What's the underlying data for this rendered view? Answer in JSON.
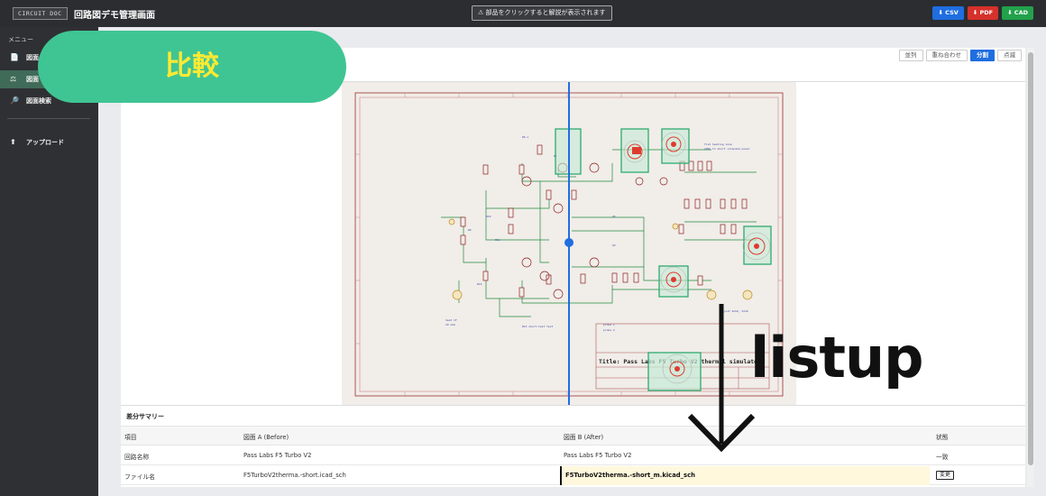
{
  "topbar": {
    "logo": "CIRCUIT DOC",
    "title": "回路図デモ管理画面",
    "hint": "⚠ 部品をクリックすると解説が表示されます",
    "exports": [
      {
        "label": "⬇ CSV"
      },
      {
        "label": "⬇ PDF"
      },
      {
        "label": "⬇ CAD"
      }
    ]
  },
  "sidebar": {
    "menu_label": "メニュー",
    "items": [
      {
        "icon": "📄",
        "label": "図面"
      },
      {
        "icon": "⚖",
        "label": "図面"
      },
      {
        "icon": "🔎",
        "label": "図面検索"
      },
      {
        "icon": "⬆",
        "label": "アップロード"
      }
    ]
  },
  "view_modes": [
    {
      "label": "並列",
      "active": false
    },
    {
      "label": "重ね合わせ",
      "active": false
    },
    {
      "label": "分割",
      "active": true
    },
    {
      "label": "点滅",
      "active": false
    }
  ],
  "summary": {
    "title": "差分サマリー",
    "headers": [
      "項目",
      "図面 A (Before)",
      "図面 B (After)",
      "状態"
    ],
    "rows": [
      {
        "item": "回路名称",
        "a": "Pass Labs F5 Turbo V2",
        "b": "Pass Labs F5 Turbo V2",
        "status": "一致"
      },
      {
        "item": "ファイル名",
        "a": "F5TurboV2therma.-short.icad_sch",
        "b": "F5TurboV2therma.-short_m.kicad_sch",
        "status": "変更"
      }
    ]
  },
  "schematic": {
    "title_block": "Title: Pass Labs F5 Turbo V2 thermal simulator"
  },
  "overlays": {
    "compare": "比較",
    "listup": "listup"
  },
  "colors": {
    "accent_blue": "#1f6ee0",
    "pill_green": "#3fc593",
    "pill_text": "#ffea33",
    "highlight_green": "#2eaa6e",
    "marker_red": "#e03a2f"
  }
}
